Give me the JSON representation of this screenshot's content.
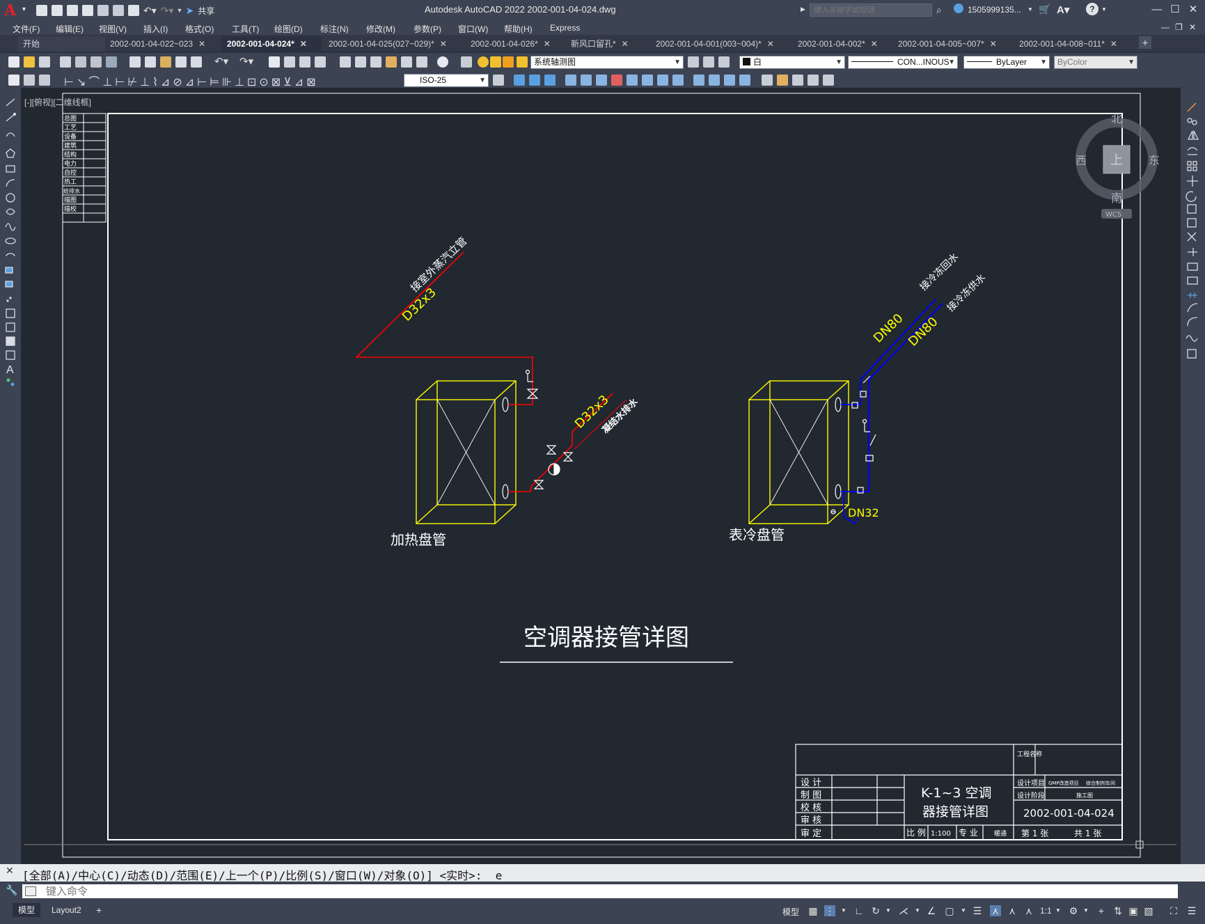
{
  "titlebar": {
    "app_title": "Autodesk AutoCAD 2022    2002-001-04-024.dwg",
    "share_label": "共享",
    "search_placeholder": "键入关键字或短语",
    "user_name": "1505999135...",
    "help_label": "?"
  },
  "menu": [
    "文件(F)",
    "编辑(E)",
    "视图(V)",
    "插入(I)",
    "格式(O)",
    "工具(T)",
    "绘图(D)",
    "标注(N)",
    "修改(M)",
    "参数(P)",
    "窗口(W)",
    "帮助(H)",
    "Express"
  ],
  "tabs": [
    {
      "label": "开始",
      "active": false,
      "closable": false
    },
    {
      "label": "2002-001-04-022~023",
      "active": false,
      "closable": true
    },
    {
      "label": "2002-001-04-024*",
      "active": true,
      "closable": true
    },
    {
      "label": "2002-001-04-025(027~029)*",
      "active": false,
      "closable": true
    },
    {
      "label": "2002-001-04-026*",
      "active": false,
      "closable": true
    },
    {
      "label": "新风口留孔*",
      "active": false,
      "closable": true
    },
    {
      "label": "2002-001-04-001(003~004)*",
      "active": false,
      "closable": true
    },
    {
      "label": "2002-001-04-002*",
      "active": false,
      "closable": true
    },
    {
      "label": "2002-001-04-005~007*",
      "active": false,
      "closable": true
    },
    {
      "label": "2002-001-04-008~011*",
      "active": false,
      "closable": true
    }
  ],
  "toolbar": {
    "layer_value": "系统轴测图",
    "color_value": "白",
    "linetype_value": "CON...INOUS",
    "lineweight_value": "ByLayer",
    "plotstyle_value": "ByColor",
    "dimstyle_value": "ISO-25"
  },
  "viewport_label": "[-][俯视][二维线框]",
  "viewcube": {
    "north": "北",
    "south": "南",
    "east": "东",
    "west": "西",
    "top": "上",
    "wcs": "WCS"
  },
  "drawing": {
    "left_table": [
      "总图",
      "工艺",
      "设备",
      "建筑",
      "结构",
      "电力",
      "自控",
      "热工",
      "给排水",
      "描图",
      "描校"
    ],
    "steam_pipe_label": "接室外蒸汽立管",
    "steam_pipe_size": "D32x3",
    "condensate_label": "凝结水排水",
    "condensate_size": "D32x3",
    "heating_coil_label": "加热盘管",
    "cooling_coil_label": "表冷盘管",
    "chilled_return_label": "接冷冻回水",
    "chilled_supply_label": "接冷冻供水",
    "dn80_a": "DN80",
    "dn80_b": "DN80",
    "dn32": "DN32",
    "main_title": "空调器接管详图",
    "titleblock": {
      "roles": [
        "设 计",
        "制 图",
        "校 核",
        "审 核",
        "审 定"
      ],
      "drawing_name_1": "K-1~3 空调",
      "drawing_name_2": "器接管详图",
      "project_name_label": "工程名称",
      "design_item_label": "设计项目",
      "design_item_value": "GMP改造项目",
      "design_item_value2": "综合制剂车间",
      "design_stage_label": "设计阶段",
      "design_stage_value": "施工图",
      "drawing_no": "2002-001-04-024",
      "scale_label": "比 例",
      "scale_value": "1:100",
      "discipline_label": "专 业",
      "discipline_value": "暖通",
      "sheet_label": "第 1 张",
      "total_label": "共 1 张"
    }
  },
  "command": {
    "history": "[全部(A)/中心(C)/动态(D)/范围(E)/上一个(P)/比例(S)/窗口(W)/对象(O)] <实时>: _e",
    "input_placeholder": "键入命令"
  },
  "status": {
    "model_tab": "模型",
    "layout_tab": "Layout2",
    "model_btn": "模型",
    "scale": "1:1"
  }
}
